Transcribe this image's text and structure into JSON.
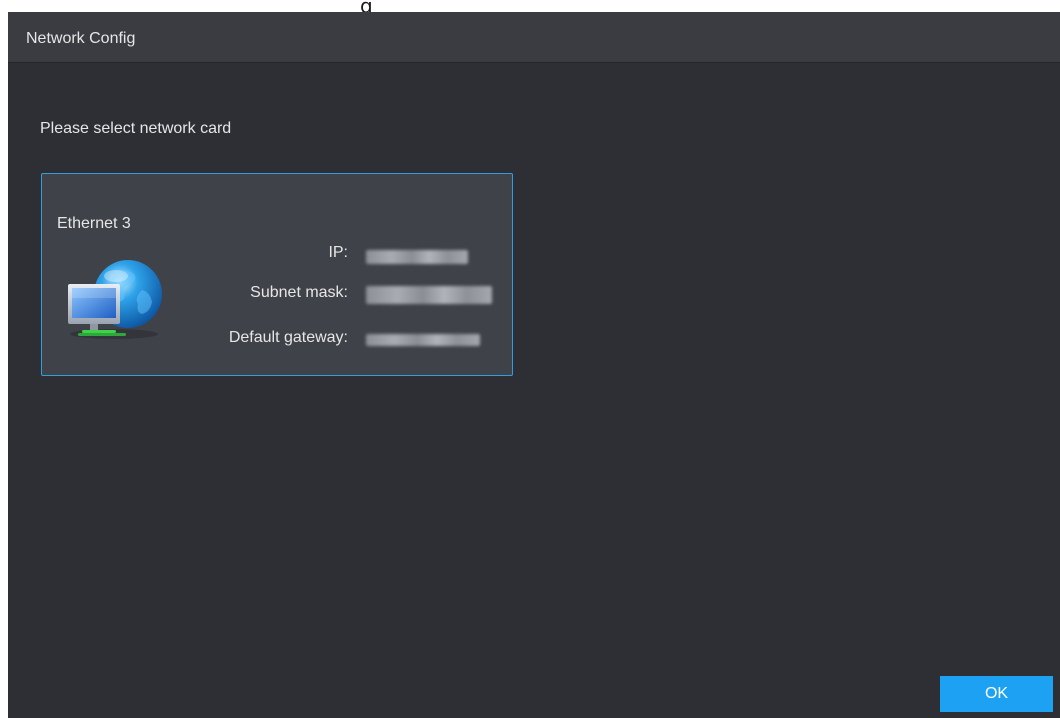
{
  "top_strip": {
    "text": "g"
  },
  "window": {
    "title": "Network Config"
  },
  "main": {
    "prompt": "Please select network card"
  },
  "network_card": {
    "name": "Ethernet 3",
    "icon": "network-computer-globe-icon",
    "fields": [
      {
        "label": "IP:",
        "value": ""
      },
      {
        "label": "Subnet mask:",
        "value": ""
      },
      {
        "label": "Default gateway:",
        "value": ""
      }
    ]
  },
  "footer": {
    "ok_label": "OK"
  },
  "colors": {
    "dialog_bg": "#2d2f35",
    "titlebar_bg": "#3a3c42",
    "card_bg": "#3f4248",
    "card_border": "#2f9fe0",
    "accent": "#1da1f2",
    "text": "#e6e6e6"
  }
}
